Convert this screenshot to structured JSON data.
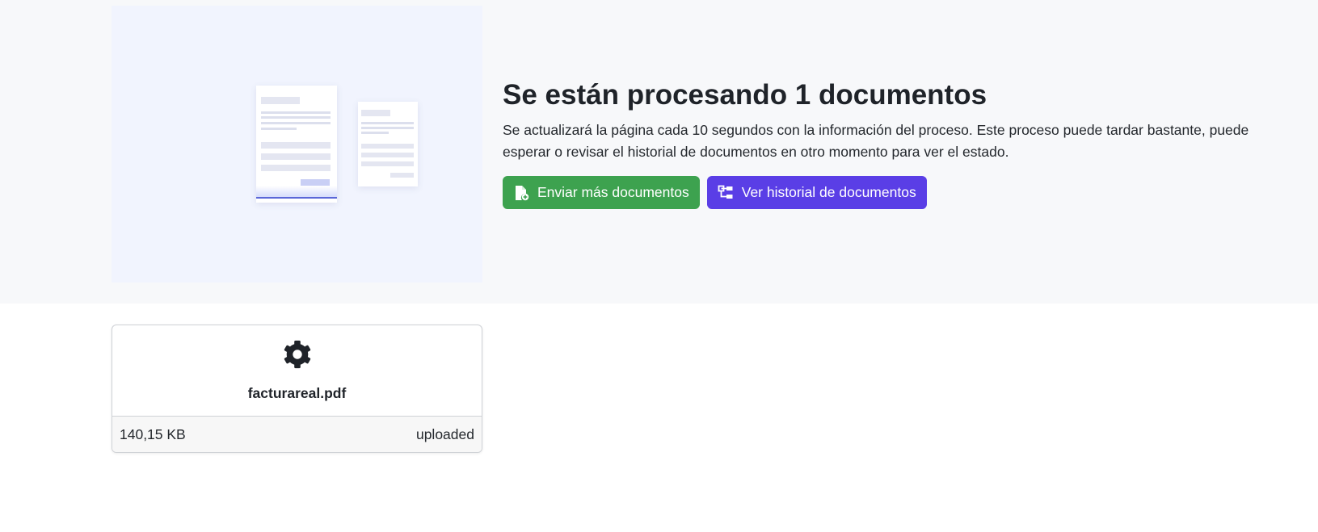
{
  "header": {
    "title": "Se están procesando 1 documentos",
    "description": "Se actualizará la página cada 10 segundos con la información del proceso. Este proceso puede tardar bastante, puede esperar o revisar el historial de documentos en otro momento para ver el estado."
  },
  "actions": {
    "send_more_label": "Enviar más documentos",
    "send_more_icon": "file-plus-icon",
    "history_label": "Ver historial de documentos",
    "history_icon": "tree-structure-icon"
  },
  "colors": {
    "green": "#3da24f",
    "purple": "#5a3ee6",
    "hero_bg": "#f7f8fa",
    "illustration_bg": "#f1f4fe"
  },
  "documents": [
    {
      "icon": "gear-icon",
      "name": "facturareal.pdf",
      "size": "140,15 KB",
      "status": "uploaded"
    }
  ]
}
